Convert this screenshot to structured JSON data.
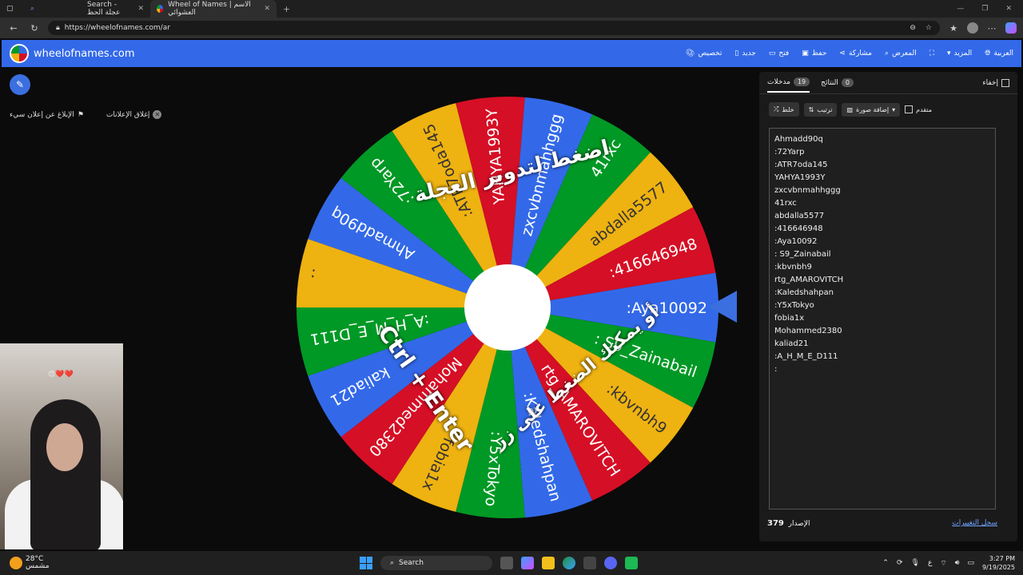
{
  "browser": {
    "tabs": [
      {
        "label": "Search - عجلة الحظ",
        "active": false
      },
      {
        "label": "Wheel of Names | الاسم العشوائي",
        "active": true
      }
    ],
    "url": "https://wheelofnames.com/ar"
  },
  "header": {
    "brand": "wheelofnames.com",
    "menu": [
      "تخصيص",
      "جديد",
      "فتح",
      "حفظ",
      "مشاركة",
      "المعرض",
      "المزيد",
      "العربية"
    ]
  },
  "left": {
    "close_ads": "إغلاق الإعلانات",
    "report_ad": "الإبلاغ عن إعلان سيء"
  },
  "wheel": {
    "overlay_click": "اضغط لتدوير العجلة",
    "overlay_or": "أو يمكنك الضغط على زر",
    "overlay_keys": "Ctrl + Enter",
    "colors": [
      "#3369e8",
      "#009925",
      "#eeb211",
      "#d50f25"
    ]
  },
  "panel": {
    "entries_tab": "مدخلات",
    "entries_count": "19",
    "results_tab": "النتائج",
    "results_count": "0",
    "hide": "إخفاء",
    "shuffle": "خلط",
    "sort": "ترتيب",
    "add_image": "إضافة صورة",
    "advanced": "متقدم",
    "entries": [
      "Ahmadd90q",
      ":72Yarp",
      ":ATR7oda145",
      "YAHYA1993Y",
      "zxcvbnmahhggg",
      "41rxc",
      "abdalla5577",
      ":416646948",
      ":Aya10092",
      ": S9_Zainabail",
      ":kbvnbh9",
      "rtg_AMAROVITCH",
      ":Kaledshahpan",
      ":Y5xTokyo",
      "fobia1x",
      "Mohammed2380",
      "kaliad21",
      ":A_H_M_E_D111",
      ":"
    ],
    "changelog": "سجل التغييرات",
    "version_label": "الإصدار",
    "version": "379"
  },
  "taskbar": {
    "temp": "28°C",
    "weather": "مشمس",
    "search": "Search",
    "time": "3:27 PM",
    "date": "9/19/2025",
    "lang": "ع"
  }
}
